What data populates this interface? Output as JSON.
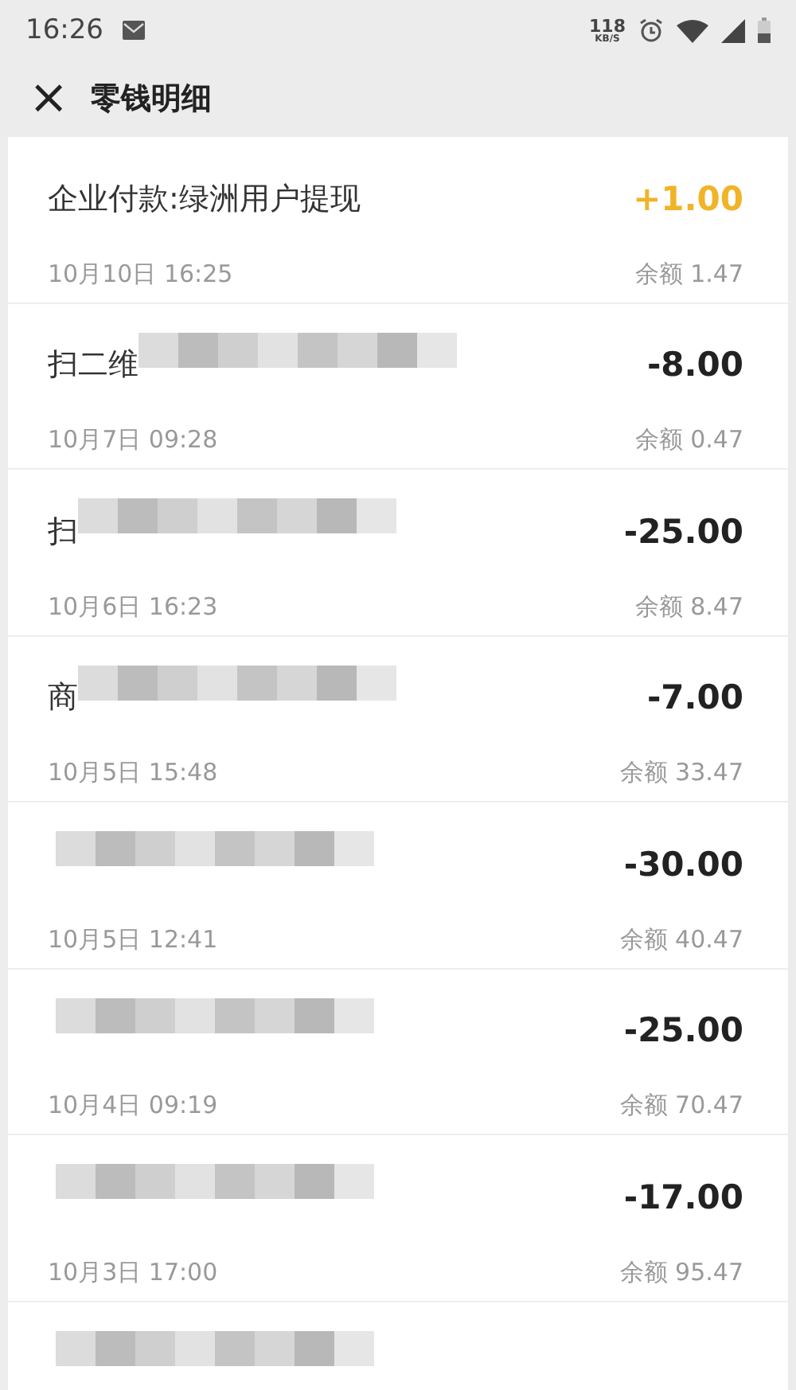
{
  "status_bar": {
    "time": "16:26",
    "speed_value": "118",
    "speed_unit": "KB/S"
  },
  "header": {
    "close": "×",
    "title": "零钱明细"
  },
  "transactions": [
    {
      "title": "企业付款:绿洲用户提现",
      "amount": "+1.00",
      "kind": "income",
      "date": "10月10日 16:25",
      "balance": "余额 1.47"
    },
    {
      "title": "扫二维",
      "amount": "-8.00",
      "kind": "expense",
      "date": "10月7日 09:28",
      "balance": "余额 0.47",
      "masked": true
    },
    {
      "title": "扫",
      "amount": "-25.00",
      "kind": "expense",
      "date": "10月6日 16:23",
      "balance": "余额 8.47",
      "masked": true
    },
    {
      "title": "商",
      "amount": "-7.00",
      "kind": "expense",
      "date": "10月5日 15:48",
      "balance": "余额 33.47",
      "masked": true
    },
    {
      "amount": "-30.00",
      "kind": "expense",
      "date": "10月5日 12:41",
      "balance": "余额 40.47",
      "masked": true
    },
    {
      "amount": "-25.00",
      "kind": "expense",
      "date": "10月4日 09:19",
      "balance": "余额 70.47",
      "masked": true
    },
    {
      "amount": "-17.00",
      "kind": "expense",
      "date": "10月3日 17:00",
      "balance": "余额 95.47",
      "masked": true
    },
    {
      "masked": true
    }
  ]
}
